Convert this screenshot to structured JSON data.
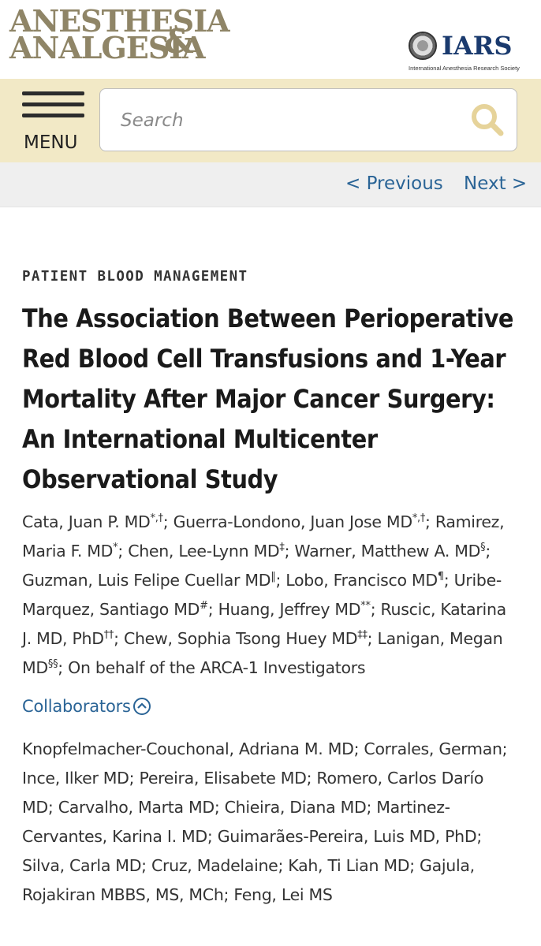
{
  "header": {
    "logo_line1": "ANESTHESIA",
    "logo_line2": "ANALGESIA",
    "logo_amp": "&",
    "society_abbr": "IARS",
    "society_name": "International Anesthesia Research Society"
  },
  "menubar": {
    "menu_label": "MENU",
    "search_placeholder": "Search",
    "search_icon": "magnifier-icon"
  },
  "nav": {
    "previous": "< Previous",
    "next": "Next >"
  },
  "article": {
    "section": "PATIENT BLOOD MANAGEMENT",
    "title": "The Association Between Perioperative Red Blood Cell Transfusions and 1-Year Mortality After Major Cancer Surgery: An International Multicenter Observational Study",
    "authors": [
      {
        "name": "Cata, Juan P. MD",
        "mark": "*,†"
      },
      {
        "name": "Guerra-Londono, Juan Jose MD",
        "mark": "*,†"
      },
      {
        "name": "Ramirez, Maria F. MD",
        "mark": "*"
      },
      {
        "name": "Chen, Lee-Lynn MD",
        "mark": "‡"
      },
      {
        "name": "Warner, Matthew A. MD",
        "mark": "§"
      },
      {
        "name": "Guzman, Luis Felipe Cuellar MD",
        "mark": "‖"
      },
      {
        "name": "Lobo, Francisco MD",
        "mark": "¶"
      },
      {
        "name": "Uribe-Marquez, Santiago MD",
        "mark": "#"
      },
      {
        "name": "Huang, Jeffrey MD",
        "mark": "**"
      },
      {
        "name": "Ruscic, Katarina J. MD, PhD",
        "mark": "††"
      },
      {
        "name": "Chew, Sophia Tsong Huey MD",
        "mark": "‡‡"
      },
      {
        "name": "Lanigan, Megan MD",
        "mark": "§§"
      }
    ],
    "authors_suffix": " On behalf of the ARCA-1 Investigators",
    "collaborators_label": "Collaborators",
    "collaborators": "Knopfelmacher-Couchonal, Adriana M. MD; Corrales, German; Ince, Ilker MD; Pereira, Elisabete MD; Romero, Carlos Darío MD; Carvalho, Marta MD; Chieira, Diana MD; Martinez-Cervantes, Karina I. MD; Guimarães-Pereira, Luis MD, PhD; Silva, Carla MD; Cruz, Madelaine; Kah, Ti Lian MD; Gajula, Rojakiran MBBS, MS, MCh; Feng, Lei MS"
  },
  "colors": {
    "logo_gold": "#8f8567",
    "menubar_bg": "#f2e9c6",
    "link_blue": "#2a6496",
    "search_icon_gold": "#e6d39a"
  }
}
